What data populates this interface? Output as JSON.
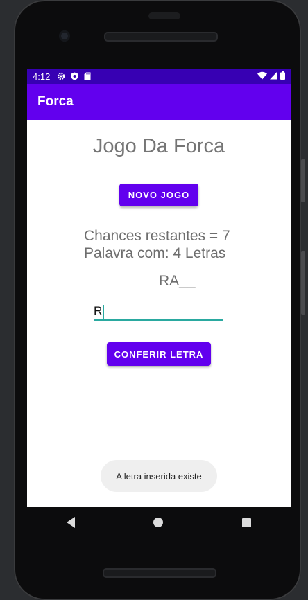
{
  "status_bar": {
    "time": "4:12",
    "left_icons": [
      "gear-icon",
      "shield-icon",
      "sd-card-icon"
    ],
    "right_icons": [
      "wifi-icon",
      "signal-icon",
      "battery-icon"
    ],
    "color": "#3700b3"
  },
  "app_bar": {
    "title": "Forca",
    "color": "#6200ee"
  },
  "main": {
    "title": "Jogo Da Forca",
    "new_game_label": "NOVO JOGO",
    "chances_text": "Chances restantes = 7",
    "word_length_text": "Palavra com: 4 Letras",
    "word_display": "RA__",
    "letter_input_value": "R",
    "check_letter_label": "CONFERIR LETRA",
    "accent_color": "#6200ee",
    "input_underline_color": "#2aa9a0"
  },
  "toast": {
    "message": "A letra inserida existe"
  },
  "nav_bar": {
    "buttons": [
      "back-icon",
      "home-icon",
      "recents-icon"
    ]
  }
}
